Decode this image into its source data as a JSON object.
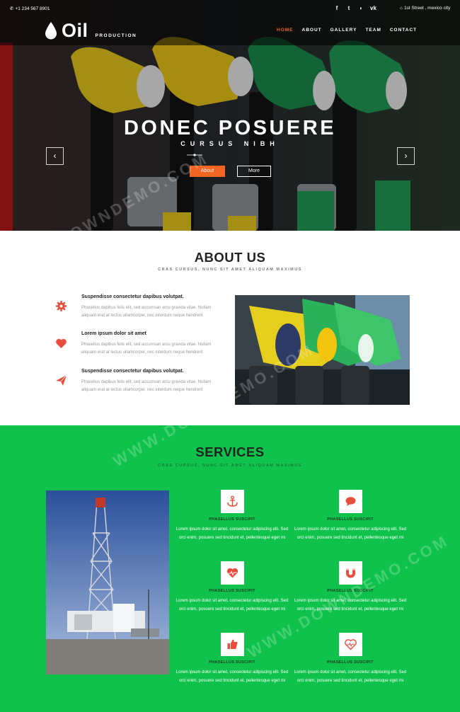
{
  "topbar": {
    "phone": "+1 234 567 8901",
    "address": "1st Street , mexico city",
    "socials": [
      "facebook-icon",
      "twitter-icon",
      "rss-icon",
      "vk-icon"
    ]
  },
  "logo": {
    "word": "Oil",
    "sub": "PRODUCTION"
  },
  "nav": {
    "items": [
      {
        "label": "HOME",
        "active": true
      },
      {
        "label": "ABOUT"
      },
      {
        "label": "GALLERY"
      },
      {
        "label": "TEAM"
      },
      {
        "label": "CONTACT"
      }
    ]
  },
  "hero": {
    "title": "DONEC POSUERE",
    "subtitle": "CURSUS NIBH",
    "about_label": "About",
    "more_label": "More",
    "prev_label": "‹",
    "next_label": "›"
  },
  "about": {
    "title": "ABOUT US",
    "tagline": "CRAS CURSUS, NUNC SIT AMET ALIQUAM MAXIMUS",
    "features": [
      {
        "icon": "gear-icon",
        "title": "Suspendisse consectetur dapibus volutpat.",
        "text": "Phasellus dapibus felis elit, sed accumsan arcu gravida vitae. Nullam aliquam erat at lectus ullamcorper, nec interdum neque hendrerit"
      },
      {
        "icon": "heart-icon",
        "title": "Lorem ipsum dolor sit amet",
        "text": "Phasellus dapibus felis elit, sed accumsan arcu gravida vitae. Nullam aliquam erat at lectus ullamcorper, nec interdum neque hendrerit"
      },
      {
        "icon": "paper-plane-icon",
        "title": "Suspendisse consectetur dapibus volutpat.",
        "text": "Phasellus dapibus felis elit, sed accumsan arcu gravida vitae. Nullam aliquam erat at lectus ullamcorper, nec interdum neque hendrerit"
      }
    ]
  },
  "services": {
    "title": "SERVICES",
    "tagline": "CRAS CURSUS, NUNC SIT AMET ALIQUAM MAXIMUS",
    "items": [
      {
        "icon": "anchor-icon",
        "title": "PHASELLUS SUSCIPIT",
        "text": "Lorem ipsum dolor sit amet, consectetur adipiscing elit. Sed orci enim, posuere sed tincidunt et, pellentesque eget mi"
      },
      {
        "icon": "speech-bubble-icon",
        "title": "PHASELLUS SUSCIPIT",
        "text": "Lorem ipsum dolor sit amet, consectetur adipiscing elit. Sed orci enim, posuere sed tincidunt et, pellentesque eget mi"
      },
      {
        "icon": "heartbeat-icon",
        "title": "PHASELLUS SUSCIPIT",
        "text": "Lorem ipsum dolor sit amet, consectetur adipiscing elit. Sed orci enim, posuere sed tincidunt et, pellentesque eget mi"
      },
      {
        "icon": "magnet-icon",
        "title": "PHASELLUS SUSCIPIT",
        "text": "Lorem ipsum dolor sit amet, consectetur adipiscing elit. Sed orci enim, posuere sed tincidunt et, pellentesque eget mi"
      },
      {
        "icon": "thumbs-up-icon",
        "title": "PHASELLUS SUSCIPIT",
        "text": "Lorem ipsum dolor sit amet, consectetur adipiscing elit. Sed orci enim, posuere sed tincidunt et, pellentesque eget mi"
      },
      {
        "icon": "heart-pulse-icon",
        "title": "PHASELLUS SUSCIPIT",
        "text": "Lorem ipsum dolor sit amet, consectetur adipiscing elit. Sed orci enim, posuere sed tincidunt et, pellentesque eget mi"
      }
    ]
  },
  "watermark": "WWW.DOWNDEMO.COM",
  "colors": {
    "accent": "#f26522",
    "services_bg": "#0fc24b",
    "icon_red": "#e74c3c"
  }
}
